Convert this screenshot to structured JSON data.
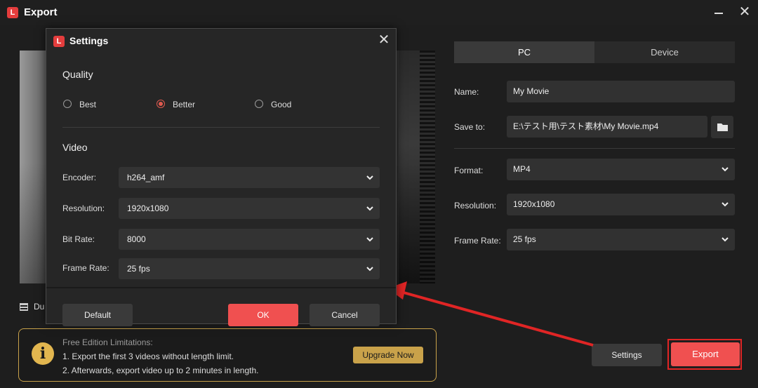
{
  "window": {
    "title": "Export",
    "logo_text": "L"
  },
  "tabs": {
    "pc": "PC",
    "device": "Device"
  },
  "fields": {
    "name_label": "Name:",
    "name_value": "My Movie",
    "save_label": "Save to:",
    "save_value": "E:\\テスト用\\テスト素材\\My Movie.mp4",
    "format_label": "Format:",
    "format_value": "MP4",
    "resolution_label": "Resolution:",
    "resolution_value": "1920x1080",
    "framerate_label": "Frame Rate:",
    "framerate_value": "25 fps"
  },
  "duration_text": "Du",
  "limits": {
    "title": "Free Edition Limitations:",
    "line1": "1. Export the first 3 videos without length limit.",
    "line2": "2. Afterwards, export video up to 2 minutes in length.",
    "upgrade": "Upgrade Now"
  },
  "buttons": {
    "settings": "Settings",
    "export": "Export"
  },
  "dialog": {
    "title": "Settings",
    "quality_head": "Quality",
    "quality_options": [
      "Best",
      "Better",
      "Good"
    ],
    "quality_selected": "Better",
    "video_head": "Video",
    "encoder_label": "Encoder:",
    "encoder_value": "h264_amf",
    "resolution_label": "Resolution:",
    "resolution_value": "1920x1080",
    "bitrate_label": "Bit Rate:",
    "bitrate_value": "8000",
    "framerate_label": "Frame Rate:",
    "framerate_value": "25 fps",
    "default_btn": "Default",
    "ok_btn": "OK",
    "cancel_btn": "Cancel"
  },
  "colors": {
    "accent": "#f05050",
    "gold": "#c9a24a",
    "annotation_red": "#e02525"
  }
}
